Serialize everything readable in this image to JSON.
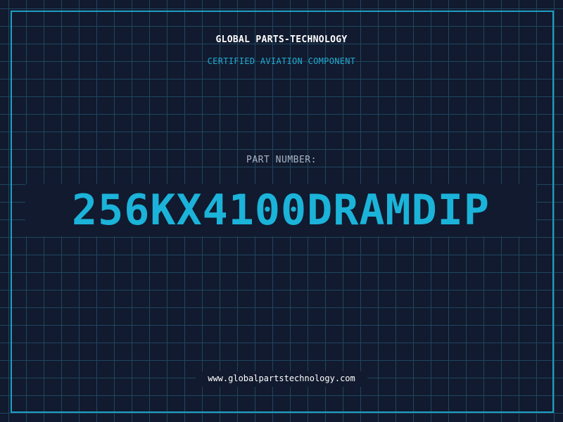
{
  "header": {
    "company": "GLOBAL PARTS-TECHNOLOGY",
    "tagline": "CERTIFIED AVIATION COMPONENT"
  },
  "part": {
    "label": "PART NUMBER:",
    "number": "256KX4100DRAMDIP"
  },
  "footer": {
    "website": "www.globalpartstechnology.com"
  },
  "colors": {
    "background": "#111a2e",
    "grid": "#1f4660",
    "accent": "#1bb3d9",
    "border": "#1e9fc4"
  }
}
